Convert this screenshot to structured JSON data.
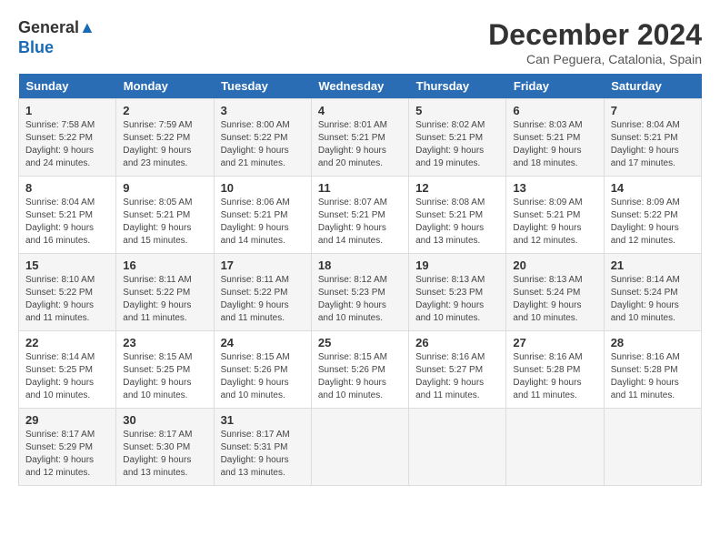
{
  "logo": {
    "line1": "General",
    "line2": "Blue"
  },
  "title": "December 2024",
  "subtitle": "Can Peguera, Catalonia, Spain",
  "days_of_week": [
    "Sunday",
    "Monday",
    "Tuesday",
    "Wednesday",
    "Thursday",
    "Friday",
    "Saturday"
  ],
  "weeks": [
    [
      {
        "day": "1",
        "info": "Sunrise: 7:58 AM\nSunset: 5:22 PM\nDaylight: 9 hours\nand 24 minutes."
      },
      {
        "day": "2",
        "info": "Sunrise: 7:59 AM\nSunset: 5:22 PM\nDaylight: 9 hours\nand 23 minutes."
      },
      {
        "day": "3",
        "info": "Sunrise: 8:00 AM\nSunset: 5:22 PM\nDaylight: 9 hours\nand 21 minutes."
      },
      {
        "day": "4",
        "info": "Sunrise: 8:01 AM\nSunset: 5:21 PM\nDaylight: 9 hours\nand 20 minutes."
      },
      {
        "day": "5",
        "info": "Sunrise: 8:02 AM\nSunset: 5:21 PM\nDaylight: 9 hours\nand 19 minutes."
      },
      {
        "day": "6",
        "info": "Sunrise: 8:03 AM\nSunset: 5:21 PM\nDaylight: 9 hours\nand 18 minutes."
      },
      {
        "day": "7",
        "info": "Sunrise: 8:04 AM\nSunset: 5:21 PM\nDaylight: 9 hours\nand 17 minutes."
      }
    ],
    [
      {
        "day": "8",
        "info": "Sunrise: 8:04 AM\nSunset: 5:21 PM\nDaylight: 9 hours\nand 16 minutes."
      },
      {
        "day": "9",
        "info": "Sunrise: 8:05 AM\nSunset: 5:21 PM\nDaylight: 9 hours\nand 15 minutes."
      },
      {
        "day": "10",
        "info": "Sunrise: 8:06 AM\nSunset: 5:21 PM\nDaylight: 9 hours\nand 14 minutes."
      },
      {
        "day": "11",
        "info": "Sunrise: 8:07 AM\nSunset: 5:21 PM\nDaylight: 9 hours\nand 14 minutes."
      },
      {
        "day": "12",
        "info": "Sunrise: 8:08 AM\nSunset: 5:21 PM\nDaylight: 9 hours\nand 13 minutes."
      },
      {
        "day": "13",
        "info": "Sunrise: 8:09 AM\nSunset: 5:21 PM\nDaylight: 9 hours\nand 12 minutes."
      },
      {
        "day": "14",
        "info": "Sunrise: 8:09 AM\nSunset: 5:22 PM\nDaylight: 9 hours\nand 12 minutes."
      }
    ],
    [
      {
        "day": "15",
        "info": "Sunrise: 8:10 AM\nSunset: 5:22 PM\nDaylight: 9 hours\nand 11 minutes."
      },
      {
        "day": "16",
        "info": "Sunrise: 8:11 AM\nSunset: 5:22 PM\nDaylight: 9 hours\nand 11 minutes."
      },
      {
        "day": "17",
        "info": "Sunrise: 8:11 AM\nSunset: 5:22 PM\nDaylight: 9 hours\nand 11 minutes."
      },
      {
        "day": "18",
        "info": "Sunrise: 8:12 AM\nSunset: 5:23 PM\nDaylight: 9 hours\nand 10 minutes."
      },
      {
        "day": "19",
        "info": "Sunrise: 8:13 AM\nSunset: 5:23 PM\nDaylight: 9 hours\nand 10 minutes."
      },
      {
        "day": "20",
        "info": "Sunrise: 8:13 AM\nSunset: 5:24 PM\nDaylight: 9 hours\nand 10 minutes."
      },
      {
        "day": "21",
        "info": "Sunrise: 8:14 AM\nSunset: 5:24 PM\nDaylight: 9 hours\nand 10 minutes."
      }
    ],
    [
      {
        "day": "22",
        "info": "Sunrise: 8:14 AM\nSunset: 5:25 PM\nDaylight: 9 hours\nand 10 minutes."
      },
      {
        "day": "23",
        "info": "Sunrise: 8:15 AM\nSunset: 5:25 PM\nDaylight: 9 hours\nand 10 minutes."
      },
      {
        "day": "24",
        "info": "Sunrise: 8:15 AM\nSunset: 5:26 PM\nDaylight: 9 hours\nand 10 minutes."
      },
      {
        "day": "25",
        "info": "Sunrise: 8:15 AM\nSunset: 5:26 PM\nDaylight: 9 hours\nand 10 minutes."
      },
      {
        "day": "26",
        "info": "Sunrise: 8:16 AM\nSunset: 5:27 PM\nDaylight: 9 hours\nand 11 minutes."
      },
      {
        "day": "27",
        "info": "Sunrise: 8:16 AM\nSunset: 5:28 PM\nDaylight: 9 hours\nand 11 minutes."
      },
      {
        "day": "28",
        "info": "Sunrise: 8:16 AM\nSunset: 5:28 PM\nDaylight: 9 hours\nand 11 minutes."
      }
    ],
    [
      {
        "day": "29",
        "info": "Sunrise: 8:17 AM\nSunset: 5:29 PM\nDaylight: 9 hours\nand 12 minutes."
      },
      {
        "day": "30",
        "info": "Sunrise: 8:17 AM\nSunset: 5:30 PM\nDaylight: 9 hours\nand 13 minutes."
      },
      {
        "day": "31",
        "info": "Sunrise: 8:17 AM\nSunset: 5:31 PM\nDaylight: 9 hours\nand 13 minutes."
      },
      {
        "day": "",
        "info": ""
      },
      {
        "day": "",
        "info": ""
      },
      {
        "day": "",
        "info": ""
      },
      {
        "day": "",
        "info": ""
      }
    ]
  ]
}
